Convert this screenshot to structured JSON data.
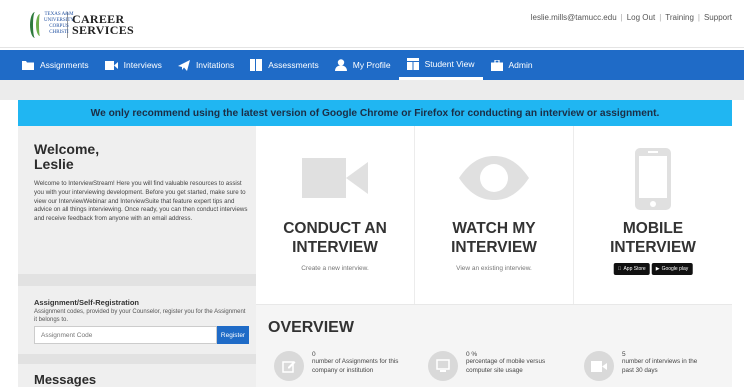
{
  "header": {
    "logo": {
      "university": "TEXAS A&M UNIVERSITY CORPUS CHRISTI",
      "line1": "CAREER",
      "line2": "SERVICES"
    },
    "user_email": "leslie.mills@tamucc.edu",
    "links": [
      "Log Out",
      "Training",
      "Support"
    ],
    "separator": "|"
  },
  "nav": {
    "items": [
      {
        "label": "Assignments",
        "icon": "folder-icon"
      },
      {
        "label": "Interviews",
        "icon": "video-camera-icon"
      },
      {
        "label": "Invitations",
        "icon": "paper-plane-icon"
      },
      {
        "label": "Assessments",
        "icon": "book-icon"
      },
      {
        "label": "My Profile",
        "icon": "user-icon"
      },
      {
        "label": "Student View",
        "icon": "window-icon",
        "active": true
      },
      {
        "label": "Admin",
        "icon": "briefcase-icon"
      }
    ]
  },
  "alert": {
    "text": "We only recommend using the latest version of Google Chrome or Firefox for conducting an interview or assignment.",
    "color": "#20b6f2"
  },
  "sidebar": {
    "welcome_line1": "Welcome,",
    "welcome_line2": "Leslie",
    "welcome_text": "Welcome to InterviewStream! Here you will find valuable resources to assist you with your interviewing development. Before you get started, make sure to view our InterviewWebinar and InterviewSuite that feature expert tips and advice on all things interviewing. Once ready, you can then conduct interviews and receive feedback from anyone with an email address.",
    "registration_title": "Assignment/Self-Registration",
    "registration_text": "Assignment codes, provided by your Counselor, register you for the Assignment it belongs to.",
    "code_placeholder": "Assignment Code",
    "register_label": "Register",
    "messages_title": "Messages"
  },
  "cards": [
    {
      "title_line1": "CONDUCT AN",
      "title_line2": "INTERVIEW",
      "subtitle": "Create a new interview.",
      "icon": "video-camera-icon"
    },
    {
      "title_line1": "WATCH MY",
      "title_line2": "INTERVIEW",
      "subtitle": "View an existing interview.",
      "icon": "eye-icon"
    },
    {
      "title_line1": "MOBILE",
      "title_line2": "INTERVIEW",
      "icon": "smartphone-icon",
      "badges": [
        "App Store",
        "Google play"
      ]
    }
  ],
  "overview": {
    "title": "OVERVIEW",
    "stats": [
      {
        "value": "0",
        "label": "number of Assignments for this company or institution",
        "icon": "edit-icon"
      },
      {
        "value": "0 %",
        "label": "percentage of mobile versus computer site usage",
        "icon": "monitor-icon"
      },
      {
        "value": "5",
        "label": "number of interviews in the past 30 days",
        "icon": "video-camera-icon"
      }
    ]
  },
  "colors": {
    "nav_bg": "#1f6bc7",
    "alert_bg": "#20b6f2",
    "sidebar_bg": "#efefef"
  }
}
